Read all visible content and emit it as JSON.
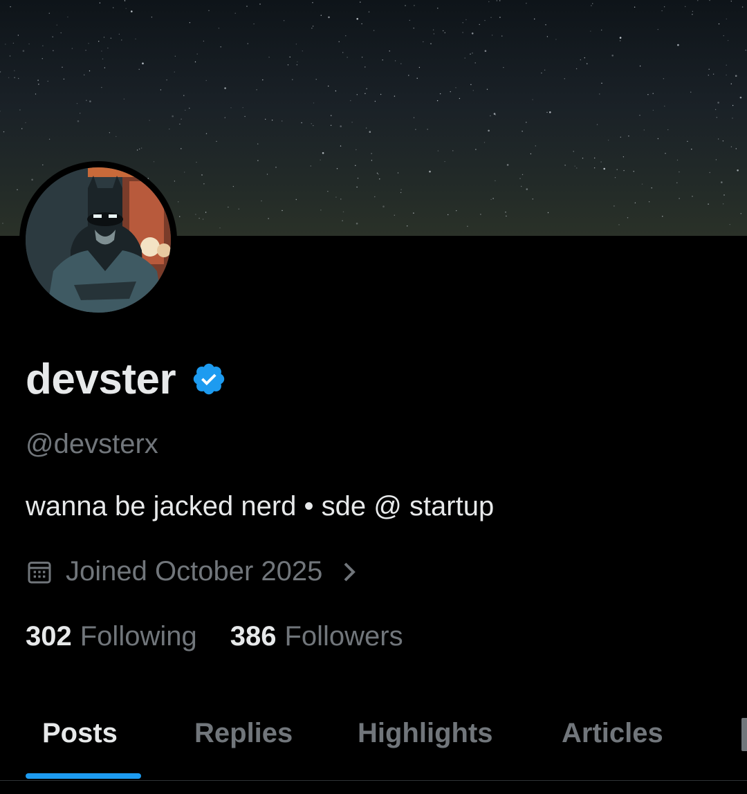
{
  "profile": {
    "display_name": "devster",
    "handle": "@devsterx",
    "bio": "wanna be jacked nerd • sde @ startup",
    "joined": "Joined October 2025",
    "following_count": "302",
    "following_label": "Following",
    "followers_count": "386",
    "followers_label": "Followers",
    "verified": true
  },
  "tabs": [
    {
      "label": "Posts",
      "active": true
    },
    {
      "label": "Replies",
      "active": false
    },
    {
      "label": "Highlights",
      "active": false
    },
    {
      "label": "Articles",
      "active": false
    }
  ],
  "colors": {
    "background": "#000000",
    "accent": "#1d9bf0",
    "primary_text": "#e7e9ea",
    "secondary_text": "#71767b"
  },
  "icons": {
    "verified": "verified-badge-icon",
    "calendar": "calendar-icon",
    "chevron": "chevron-right-icon"
  }
}
